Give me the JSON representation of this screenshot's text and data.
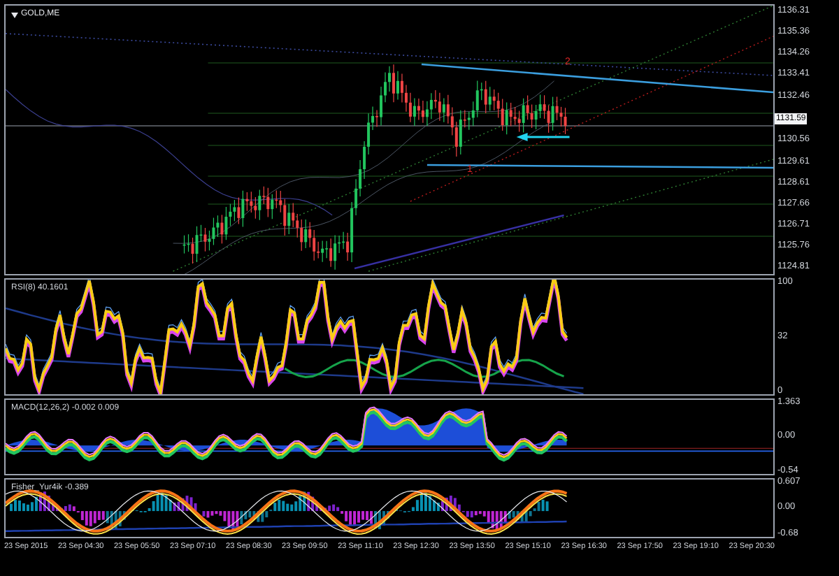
{
  "chart": {
    "symbol": "GOLD,ME",
    "annotations": [
      "2",
      "1"
    ],
    "price_axis": [
      {
        "label": "1136.31",
        "highlighted": false
      },
      {
        "label": "1135.36",
        "highlighted": false
      },
      {
        "label": "1134.26",
        "highlighted": false
      },
      {
        "label": "1133.41",
        "highlighted": false
      },
      {
        "label": "1132.46",
        "highlighted": false
      },
      {
        "label": "1131.59",
        "highlighted": true
      },
      {
        "label": "1130.56",
        "highlighted": false
      },
      {
        "label": "1129.61",
        "highlighted": false
      },
      {
        "label": "1128.61",
        "highlighted": false
      },
      {
        "label": "1127.66",
        "highlighted": false
      },
      {
        "label": "1126.71",
        "highlighted": false
      },
      {
        "label": "1125.76",
        "highlighted": false
      },
      {
        "label": "1124.81",
        "highlighted": false
      }
    ]
  },
  "rsi": {
    "title": "RSI(8) 40.1601",
    "axis": [
      "100",
      "32",
      "0"
    ]
  },
  "macd": {
    "title": "MACD(12,26,2) -0.002 0.009",
    "axis": [
      "1.363",
      "0.00",
      "-0.54"
    ]
  },
  "fisher": {
    "title": "Fisher_Yur4ik -0.389",
    "axis": [
      "0.607",
      "0.00",
      "-0.68"
    ]
  },
  "time_axis": [
    "23 Sep 2015",
    "23 Sep 04:30",
    "23 Sep 05:50",
    "23 Sep 07:10",
    "23 Sep 08:30",
    "23 Sep 09:50",
    "23 Sep 11:10",
    "23 Sep 12:30",
    "23 Sep 13:50",
    "23 Sep 15:10",
    "23 Sep 16:30",
    "23 Sep 17:50",
    "23 Sep 19:10",
    "23 Sep 20:30"
  ]
}
